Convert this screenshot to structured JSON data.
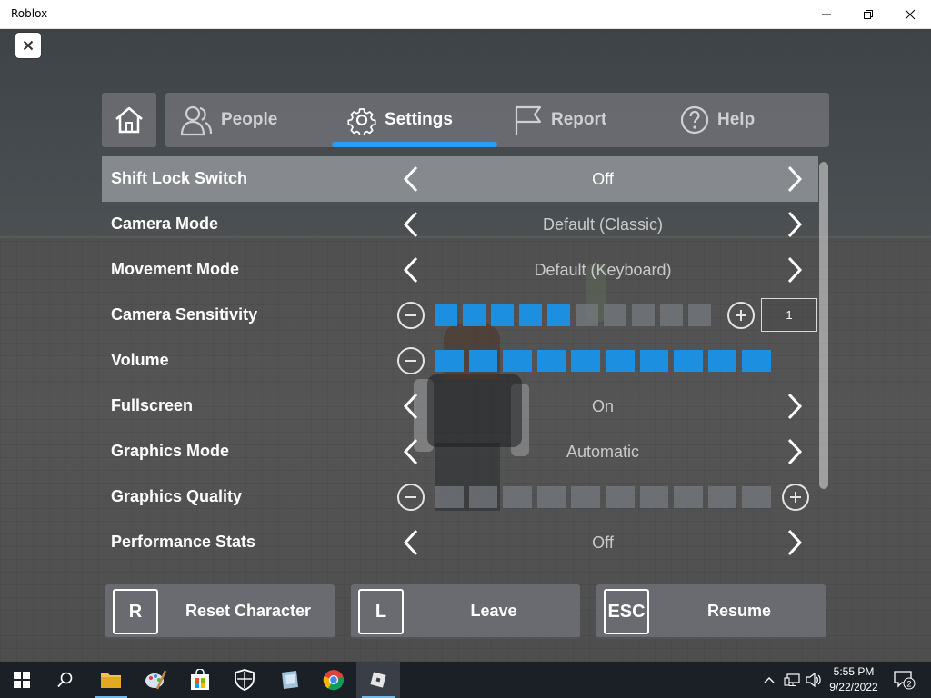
{
  "window": {
    "title": "Roblox",
    "buttons": [
      "minimize-icon",
      "restore-icon",
      "close-icon"
    ]
  },
  "menu": {
    "close_icon": "close-icon",
    "tabs": [
      {
        "icon": "home-icon",
        "label": ""
      },
      {
        "icon": "people-icon",
        "label": "People"
      },
      {
        "icon": "gear-icon",
        "label": "Settings",
        "active": true
      },
      {
        "icon": "flag-icon",
        "label": "Report"
      },
      {
        "icon": "help-icon",
        "label": "Help"
      }
    ]
  },
  "settings": {
    "rows": [
      {
        "label": "Shift Lock Switch",
        "value": "Off",
        "type": "selector",
        "highlighted": true
      },
      {
        "label": "Camera Mode",
        "value": "Default (Classic)",
        "type": "selector"
      },
      {
        "label": "Movement Mode",
        "value": "Default (Keyboard)",
        "type": "selector"
      },
      {
        "label": "Camera Sensitivity",
        "type": "slider",
        "level": 5,
        "segments": 10,
        "input_value": "1"
      },
      {
        "label": "Volume",
        "type": "slider",
        "level": 10,
        "segments": 10
      },
      {
        "label": "Fullscreen",
        "value": "On",
        "type": "selector"
      },
      {
        "label": "Graphics Mode",
        "value": "Automatic",
        "type": "selector"
      },
      {
        "label": "Graphics Quality",
        "type": "slider",
        "level": 0,
        "segments": 10
      },
      {
        "label": "Performance Stats",
        "value": "Off",
        "type": "selector"
      }
    ]
  },
  "actions": [
    {
      "key": "R",
      "label": "Reset Character"
    },
    {
      "key": "L",
      "label": "Leave"
    },
    {
      "key": "ESC",
      "label": "Resume"
    }
  ],
  "taskbar": {
    "items": [
      "windows-start-icon",
      "search-icon",
      "file-explorer-icon",
      "paint-icon",
      "store-icon",
      "security-icon",
      "app-icon",
      "chrome-icon",
      "roblox-icon"
    ],
    "time": "5:55 PM",
    "date": "9/22/2022",
    "notification_count": "2",
    "colors": {
      "accent": "#2e9cf0",
      "slider_on": "#1d8fe1"
    }
  }
}
